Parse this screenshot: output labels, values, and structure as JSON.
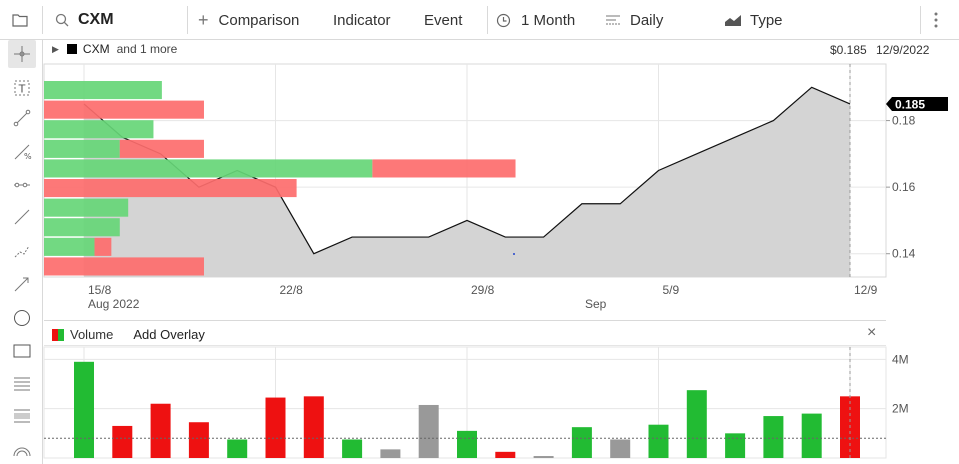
{
  "toolbar": {
    "symbol": "CXM",
    "comparison": "Comparison",
    "indicator": "Indicator",
    "event": "Event",
    "range": "1 Month",
    "interval": "Daily",
    "type": "Type"
  },
  "legend": {
    "symbol": "CXM",
    "more": "and 1 more",
    "price": "$0.185",
    "date": "12/9/2022"
  },
  "volume_panel": {
    "label": "Volume",
    "add_overlay": "Add Overlay"
  },
  "left_tools": [
    "crosshair-icon",
    "text-tool-icon",
    "line-tool-icon",
    "fib-tool-icon",
    "ray-tool-icon",
    "trendline-icon",
    "polyline-icon",
    "arrow-icon",
    "circle-icon",
    "rectangle-icon",
    "horizontal-lines-icon",
    "channel-icon",
    "arc-icon"
  ],
  "colors": {
    "up": "#22bb33",
    "down": "#ee1111",
    "neutral": "#999999",
    "area": "#d4d4d4",
    "vp_up": "#66d677",
    "vp_down": "#fd6c6c"
  },
  "chart_data": [
    {
      "type": "area",
      "x": [
        "2022-08-12",
        "2022-08-15",
        "2022-08-16",
        "2022-08-17",
        "2022-08-18",
        "2022-08-19",
        "2022-08-22",
        "2022-08-23",
        "2022-08-24",
        "2022-08-25",
        "2022-08-26",
        "2022-08-29",
        "2022-08-30",
        "2022-08-31",
        "2022-09-01",
        "2022-09-02",
        "2022-09-06",
        "2022-09-07",
        "2022-09-08",
        "2022-09-09"
      ],
      "series": [
        {
          "values": [
            0.185,
            0.175,
            0.17,
            0.16,
            0.165,
            0.16,
            0.14,
            0.145,
            0.145,
            0.145,
            0.15,
            0.145,
            0.145,
            0.155,
            0.155,
            0.165,
            0.17,
            0.175,
            0.18,
            0.19,
            0.185
          ]
        }
      ],
      "x_ticks": [
        "15/8",
        "22/8",
        "29/8",
        "5/9",
        "12/9"
      ],
      "x_ticks_sub": [
        "Aug 2022",
        "Sep"
      ],
      "y_ticks": [
        0.14,
        0.16,
        0.18
      ],
      "ylim": [
        0.133,
        0.197
      ],
      "last_value_label": "0.185",
      "volume_profile": [
        {
          "up": 0.14,
          "down": 0
        },
        {
          "up": 0.0,
          "down": 0.19
        },
        {
          "up": 0.13,
          "down": 0
        },
        {
          "up": 0.09,
          "down": 0.1
        },
        {
          "up": 0.39,
          "down": 0.17
        },
        {
          "up": 0.0,
          "down": 0.3
        },
        {
          "up": 0.1,
          "down": 0
        },
        {
          "up": 0.09,
          "down": 0
        },
        {
          "up": 0.06,
          "down": 0.02
        },
        {
          "up": 0.0,
          "down": 0.19
        }
      ]
    },
    {
      "type": "bar",
      "title": "Volume",
      "values": [
        3.9,
        1.3,
        2.2,
        1.45,
        0.75,
        2.45,
        2.5,
        0.75,
        0.35,
        2.15,
        1.1,
        0.25,
        0.08,
        1.25,
        0.75,
        1.35,
        2.75,
        1.0,
        1.7,
        1.8,
        2.5
      ],
      "colors": [
        "up",
        "down",
        "down",
        "down",
        "up",
        "down",
        "down",
        "up",
        "neutral",
        "neutral",
        "up",
        "down",
        "neutral",
        "up",
        "neutral",
        "up",
        "up",
        "up",
        "up",
        "up",
        "down"
      ],
      "y_ticks": [
        "2M",
        "4M"
      ],
      "ylim": [
        0,
        4.5
      ],
      "average": 0.8
    }
  ]
}
